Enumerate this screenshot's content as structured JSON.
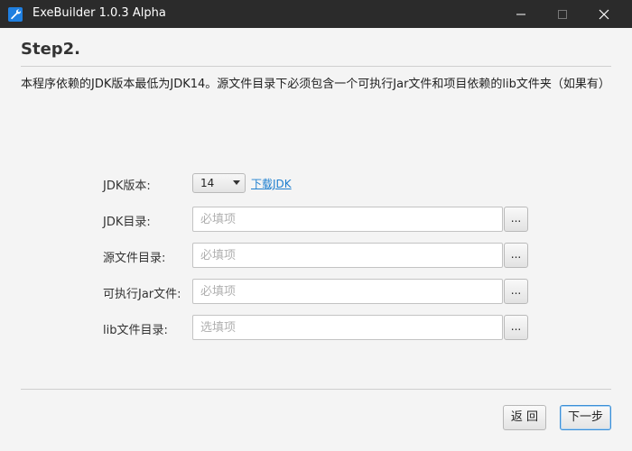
{
  "window": {
    "title": "ExeBuilder 1.0.3 Alpha",
    "icon": "wrench-icon",
    "controls": [
      "minimize-icon",
      "maximize-icon",
      "close-icon"
    ]
  },
  "step": {
    "title": "Step2.",
    "description": "本程序依赖的JDK版本最低为JDK14。源文件目录下必须包含一个可执行Jar文件和项目依赖的lib文件夹（如果有）"
  },
  "form": {
    "jdk_version": {
      "label": "JDK版本:",
      "value": "14",
      "download_link": "下载JDK"
    },
    "fields": [
      {
        "label": "JDK目录:",
        "value": "",
        "placeholder": "必填项",
        "button": "..."
      },
      {
        "label": "源文件目录:",
        "value": "",
        "placeholder": "必填项",
        "button": "..."
      },
      {
        "label": "可执行Jar文件:",
        "value": "",
        "placeholder": "必填项",
        "button": "..."
      },
      {
        "label": "lib文件目录:",
        "value": "",
        "placeholder": "选填项",
        "button": "..."
      }
    ]
  },
  "footer": {
    "back_label": "返 回",
    "next_label": "下一步"
  },
  "colors": {
    "titlebar": "#2b2b2b",
    "background": "#f4f4f4",
    "link": "#1e7fcf",
    "accent": "#3c8fd6"
  }
}
